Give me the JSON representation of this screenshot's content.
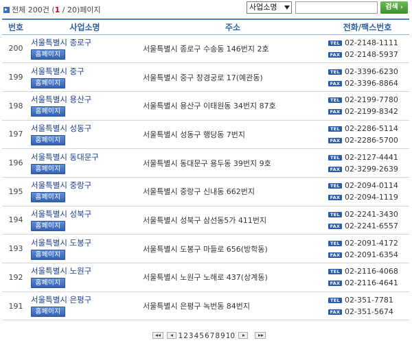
{
  "summary": {
    "total_prefix": "전체 200건 (",
    "current_page": "1",
    "total_suffix": " / 20)페이지"
  },
  "search": {
    "select_value": "사업소명",
    "button_label": "검색",
    "input_value": ""
  },
  "table": {
    "columns": [
      "번호",
      "사업소명",
      "주소",
      "전화/팩스번호"
    ],
    "home_label": "홈페이지",
    "tel_label": "TEL",
    "fax_label": "FAX",
    "rows": [
      {
        "num": "200",
        "name": "서울특별시 종로구",
        "addr": "서울특별시 종로구 수송동 146번지 2호",
        "tel": "02-2148-1111",
        "fax": "02-2148-5937"
      },
      {
        "num": "199",
        "name": "서울특별시 중구",
        "addr": "서울특별시 중구 창경궁로 17(예관동)",
        "tel": "02-3396-6230",
        "fax": "02-3396-8864"
      },
      {
        "num": "198",
        "name": "서울특별시 용산구",
        "addr": "서울특별시 용산구 이태원동 34번지 87호",
        "tel": "02-2199-7780",
        "fax": "02-2199-8342"
      },
      {
        "num": "197",
        "name": "서울특별시 성동구",
        "addr": "서울특별시 성동구 행당동 7번지",
        "tel": "02-2286-5114",
        "fax": "02-2286-5700"
      },
      {
        "num": "196",
        "name": "서울특별시 동대문구",
        "addr": "서울특별시 동대문구 용두동 39번지 9호",
        "tel": "02-2127-4441",
        "fax": "02-3299-2639"
      },
      {
        "num": "195",
        "name": "서울특별시 중랑구",
        "addr": "서울특별시 중랑구 신내동 662번지",
        "tel": "02-2094-0114",
        "fax": "02-2094-1119"
      },
      {
        "num": "194",
        "name": "서울특별시 성북구",
        "addr": "서울특별시 성북구 삼선동5가 411번지",
        "tel": "02-2241-3430",
        "fax": "02-2241-6557"
      },
      {
        "num": "193",
        "name": "서울특별시 도봉구",
        "addr": "서울특별시 도봉구 마들로 656(방학동)",
        "tel": "02-2091-4172",
        "fax": "02-2091-6354"
      },
      {
        "num": "192",
        "name": "서울특별시 노원구",
        "addr": "서울특별시 노원구 노해로 437(상계동)",
        "tel": "02-2116-4068",
        "fax": "02-2116-4641"
      },
      {
        "num": "191",
        "name": "서울특별시 은평구",
        "addr": "서울특별시 은평구 녹번동 84번지",
        "tel": "02-351-7781",
        "fax": "02-351-5674"
      }
    ]
  },
  "pagination": {
    "pages": [
      "1",
      "2",
      "3",
      "4",
      "5",
      "6",
      "7",
      "8",
      "9",
      "10"
    ],
    "current": "1"
  }
}
